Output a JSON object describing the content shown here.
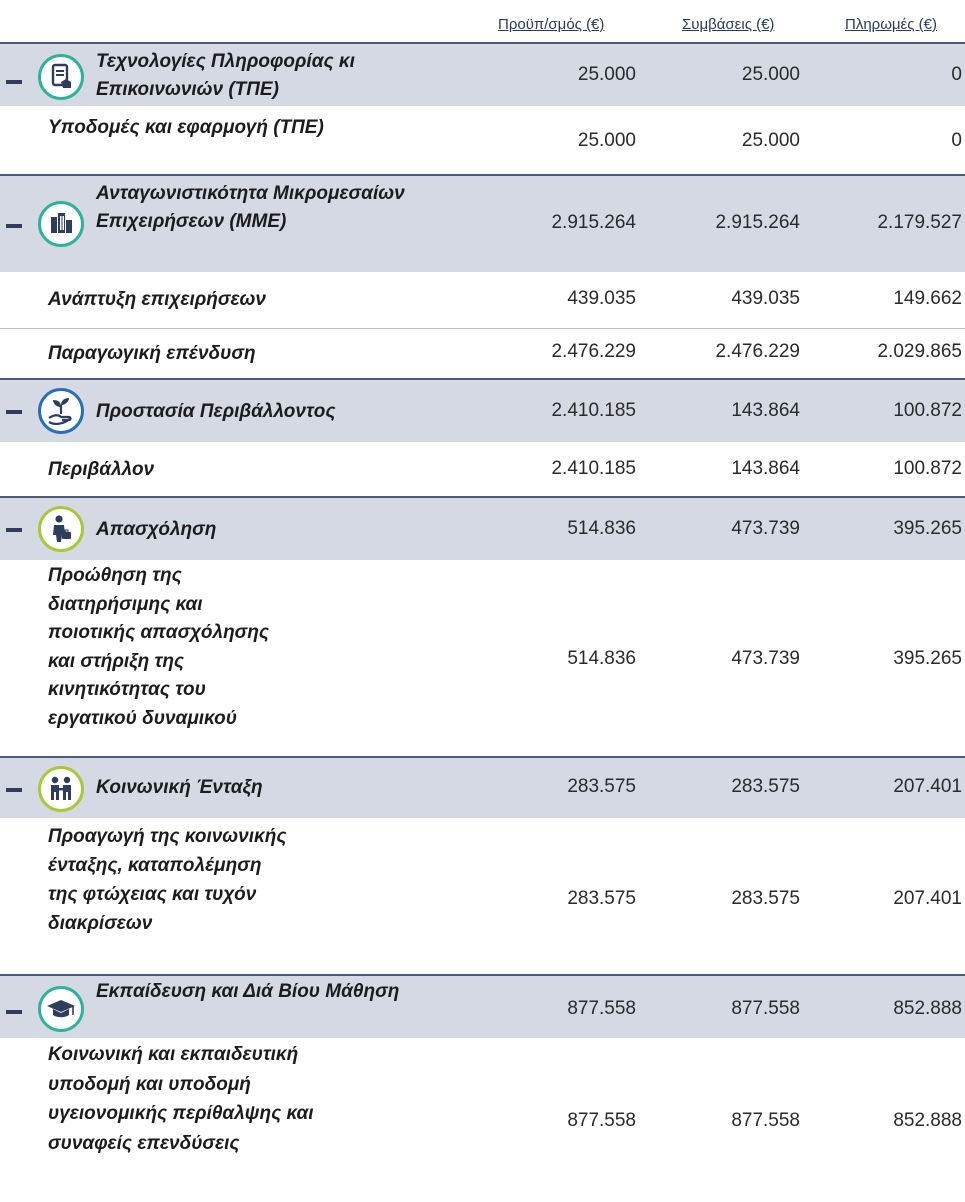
{
  "header": {
    "budget": "Προϋπ/σμός (€)",
    "contracts": "Συμβάσεις (€)",
    "payments": "Πληρωμές (€)"
  },
  "colors": {
    "category_bg": "#d4d9e4",
    "category_border": "#4a5a78",
    "ict_accent": "#2eb39a",
    "sme_accent": "#2eb39a",
    "env_accent": "#2a6fb5",
    "employment_accent": "#a8c83a",
    "inclusion_accent": "#a8c83a",
    "education_accent": "#2eb39a"
  },
  "rows": [
    {
      "kind": "category",
      "icon": "tablet-hand-icon",
      "label": "Τεχνολογίες Πληροφορίας κι Επικοινωνιών (ΤΠΕ)",
      "budget": "25.000",
      "contracts": "25.000",
      "payments": "0"
    },
    {
      "kind": "sub",
      "label": "Υποδομές και εφαρμογή (ΤΠΕ)",
      "budget": "25.000",
      "contracts": "25.000",
      "payments": "0"
    },
    {
      "kind": "category",
      "icon": "buildings-icon",
      "label": "Ανταγωνιστικότητα Μικρομεσαίων Επιχειρήσεων (ΜΜΕ)",
      "budget": "2.915.264",
      "contracts": "2.915.264",
      "payments": "2.179.527"
    },
    {
      "kind": "sub",
      "label": "Ανάπτυξη επιχειρήσεων",
      "budget": "439.035",
      "contracts": "439.035",
      "payments": "149.662"
    },
    {
      "kind": "sub",
      "label": "Παραγωγική επένδυση",
      "budget": "2.476.229",
      "contracts": "2.476.229",
      "payments": "2.029.865"
    },
    {
      "kind": "category",
      "icon": "plant-hand-icon",
      "label": "Προστασία Περιβάλλοντος",
      "budget": "2.410.185",
      "contracts": "143.864",
      "payments": "100.872"
    },
    {
      "kind": "sub",
      "label": "Περιβάλλον",
      "budget": "2.410.185",
      "contracts": "143.864",
      "payments": "100.872"
    },
    {
      "kind": "category",
      "icon": "worker-briefcase-icon",
      "label": "Απασχόληση",
      "budget": "514.836",
      "contracts": "473.739",
      "payments": "395.265"
    },
    {
      "kind": "sub",
      "label": "Προώθηση της διατηρήσιμης και ποιοτικής απασχόλησης και στήριξη της κινητικότητας του εργατικού δυναμικού",
      "budget": "514.836",
      "contracts": "473.739",
      "payments": "395.265"
    },
    {
      "kind": "category",
      "icon": "people-helping-icon",
      "label": "Κοινωνική Ένταξη",
      "budget": "283.575",
      "contracts": "283.575",
      "payments": "207.401"
    },
    {
      "kind": "sub",
      "label": "Προαγωγή της κοινωνικής ένταξης, καταπολέμηση της φτώχειας και τυχόν διακρίσεων",
      "budget": "283.575",
      "contracts": "283.575",
      "payments": "207.401"
    },
    {
      "kind": "category",
      "icon": "graduation-cap-icon",
      "label": "Εκπαίδευση και Διά Βίου Μάθηση",
      "budget": "877.558",
      "contracts": "877.558",
      "payments": "852.888"
    },
    {
      "kind": "sub",
      "label": "Κοινωνική και εκπαιδευτική υποδομή και υποδομή υγειονομικής περίθαλψης και συναφείς επενδύσεις",
      "budget": "877.558",
      "contracts": "877.558",
      "payments": "852.888"
    }
  ]
}
